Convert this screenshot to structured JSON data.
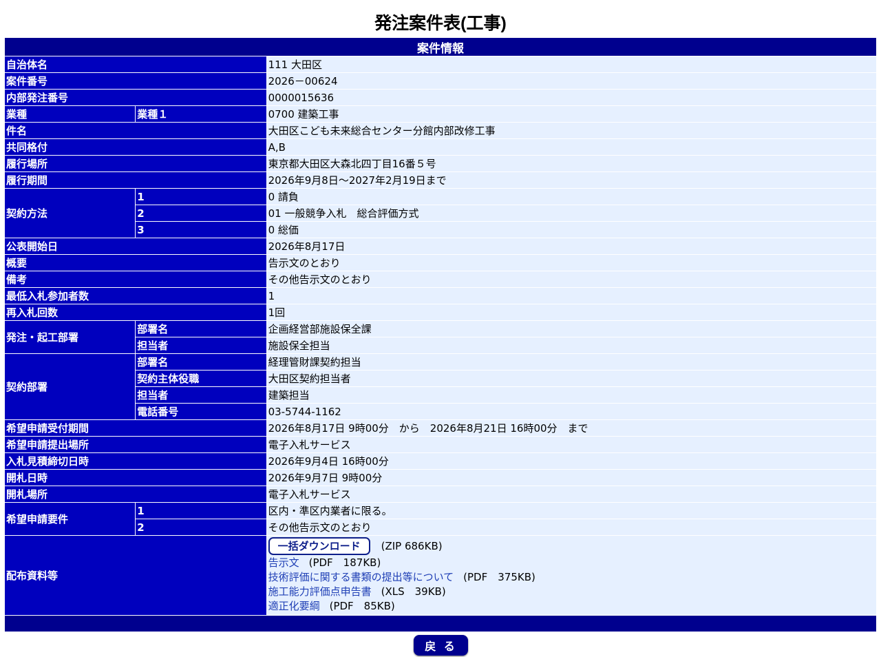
{
  "page": {
    "title": "発注案件表(工事)",
    "section_header": "案件情報",
    "back_label": "戻 る"
  },
  "rows": {
    "municipality": {
      "label": "自治体名",
      "value": "111 大田区"
    },
    "case_number": {
      "label": "案件番号",
      "value": "2026－00624"
    },
    "internal_number": {
      "label": "内部発注番号",
      "value": "0000015636"
    },
    "work_type": {
      "label": "業種",
      "sub": "業種１",
      "value": "0700 建築工事"
    },
    "project_name": {
      "label": "件名",
      "value": "大田区こども未来総合センター分館内部改修工事"
    },
    "joint_rating": {
      "label": "共同格付",
      "value": "A,B"
    },
    "location": {
      "label": "履行場所",
      "value": "東京都大田区大森北四丁目16番５号"
    },
    "period": {
      "label": "履行期間",
      "value": "2026年9月8日～2027年2月19日まで"
    },
    "contract_method": {
      "label": "契約方法",
      "items": [
        {
          "num": "1",
          "value": "0 請負"
        },
        {
          "num": "2",
          "value": "01 一般競争入札　総合評価方式"
        },
        {
          "num": "3",
          "value": "0 総価"
        }
      ]
    },
    "publish_date": {
      "label": "公表開始日",
      "value": "2026年8月17日"
    },
    "summary": {
      "label": "概要",
      "value": "告示文のとおり"
    },
    "remarks": {
      "label": "備考",
      "value": "その他告示文のとおり"
    },
    "min_bidders": {
      "label": "最低入札参加者数",
      "value": "1"
    },
    "rebid_count": {
      "label": "再入札回数",
      "value": "1回"
    },
    "ordering_dept": {
      "label": "発注・起工部署",
      "items": [
        {
          "sub": "部署名",
          "value": "企画経営部施設保全課"
        },
        {
          "sub": "担当者",
          "value": "施設保全担当"
        }
      ]
    },
    "contract_dept": {
      "label": "契約部署",
      "items": [
        {
          "sub": "部署名",
          "value": "経理管財課契約担当"
        },
        {
          "sub": "契約主体役職",
          "value": "大田区契約担当者"
        },
        {
          "sub": "担当者",
          "value": "建築担当"
        },
        {
          "sub": "電話番号",
          "value": "03-5744-1162"
        }
      ]
    },
    "application_period": {
      "label": "希望申請受付期間",
      "value": "2026年8月17日 9時00分　から　2026年8月21日 16時00分　まで"
    },
    "application_place": {
      "label": "希望申請提出場所",
      "value": "電子入札サービス"
    },
    "bid_deadline": {
      "label": "入札見積締切日時",
      "value": "2026年9月4日 16時00分"
    },
    "opening_datetime": {
      "label": "開札日時",
      "value": "2026年9月7日 9時00分"
    },
    "opening_place": {
      "label": "開札場所",
      "value": "電子入札サービス"
    },
    "application_requirements": {
      "label": "希望申請要件",
      "items": [
        {
          "num": "1",
          "value": "区内・準区内業者に限る。"
        },
        {
          "num": "2",
          "value": "その他告示文のとおり"
        }
      ]
    },
    "materials": {
      "label": "配布資料等",
      "bulk_download": {
        "label": "一括ダウンロード",
        "info": "(ZIP 686KB)"
      },
      "files": [
        {
          "name": "告示文",
          "info": "(PDF　187KB)"
        },
        {
          "name": "技術評価に関する書類の提出等について",
          "info": "(PDF　375KB)"
        },
        {
          "name": "施工能力評価点申告書",
          "info": "(XLS　39KB)"
        },
        {
          "name": "適正化要綱",
          "info": "(PDF　85KB)"
        }
      ]
    }
  },
  "colors": {
    "section_header": "#00008e",
    "label_cell": "#0000be",
    "value_cell": "#e6f0ff",
    "link": "#1f3fb5"
  }
}
